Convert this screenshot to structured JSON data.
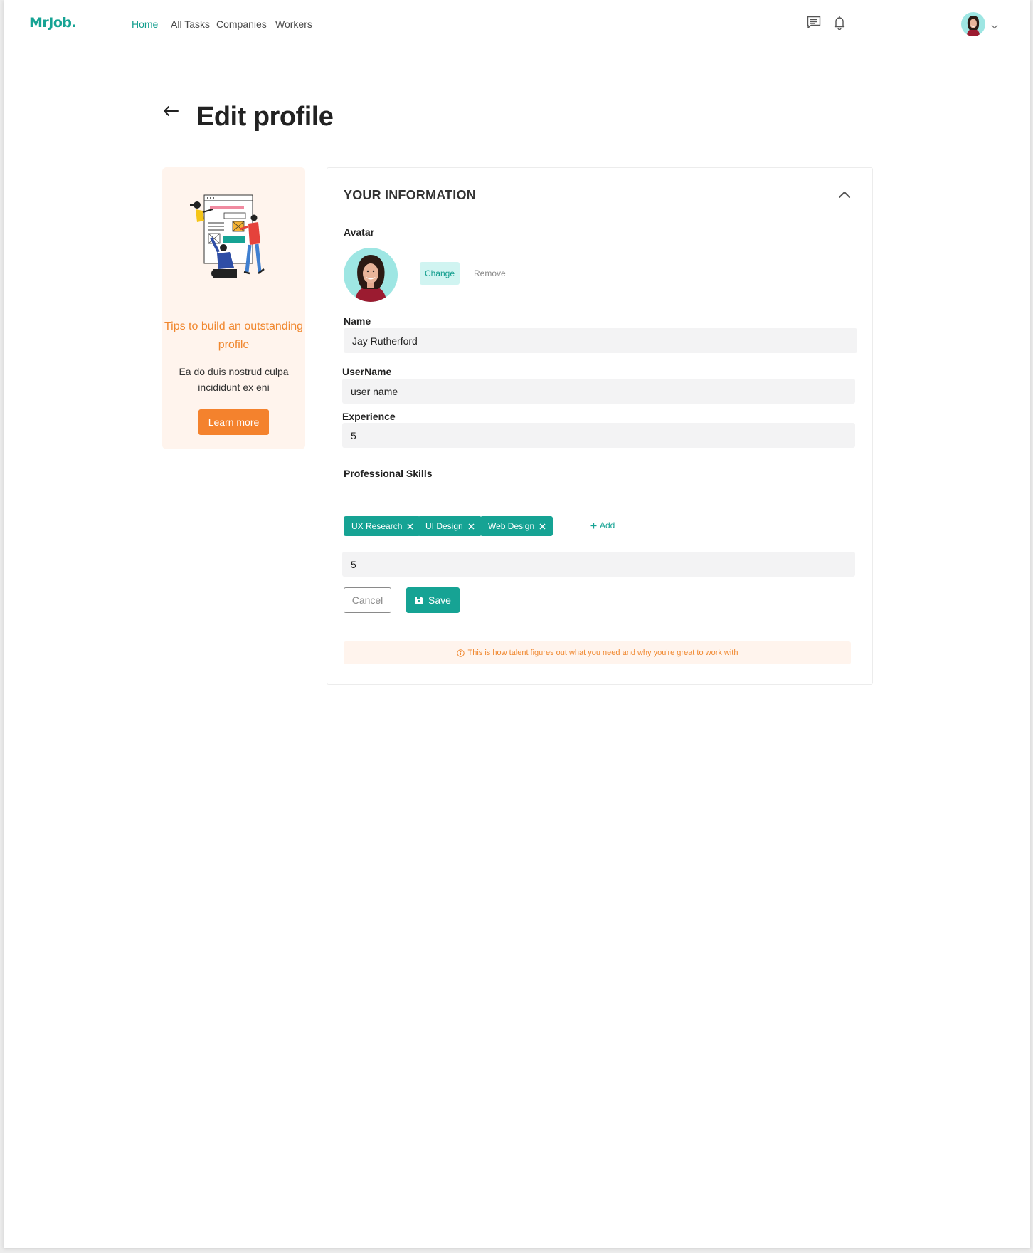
{
  "brand": {
    "logo": "MrJob."
  },
  "nav": {
    "items": [
      {
        "label": "Home",
        "active": true
      },
      {
        "label": "All Tasks",
        "active": false
      },
      {
        "label": "Companies",
        "active": false
      },
      {
        "label": "Workers",
        "active": false
      }
    ]
  },
  "header": {
    "title": "Edit profile"
  },
  "tips": {
    "title": "Tips to build an outstanding profile",
    "text": "Ea do duis nostrud culpa incididunt ex eni",
    "button": "Learn more"
  },
  "form": {
    "section_title": "YOUR INFORMATION",
    "avatar_label": "Avatar",
    "change_label": "Change",
    "remove_label": "Remove",
    "name_label": "Name",
    "name_value": "Jay Rutherford",
    "username_label": "UserName",
    "username_value": "user name",
    "experience_label": "Experience",
    "experience_value": "5",
    "skills_label": "Professional Skills",
    "skills": [
      "UX Research",
      "UI Design",
      "Web Design"
    ],
    "add_label": "Add",
    "skills_input_value": "5",
    "cancel_label": "Cancel",
    "save_label": "Save",
    "info_text": "This is how talent figures out what you need and why you're great to work with"
  },
  "colors": {
    "primary": "#16a394",
    "accent_orange": "#f4822d",
    "tips_bg": "#fff4ed",
    "field_bg": "#f3f3f4"
  },
  "icons": [
    "chat-icon",
    "bell-icon",
    "chevron-down-icon",
    "back-arrow-icon",
    "chevron-up-icon",
    "close-icon",
    "plus-icon",
    "save-icon",
    "info-icon"
  ]
}
